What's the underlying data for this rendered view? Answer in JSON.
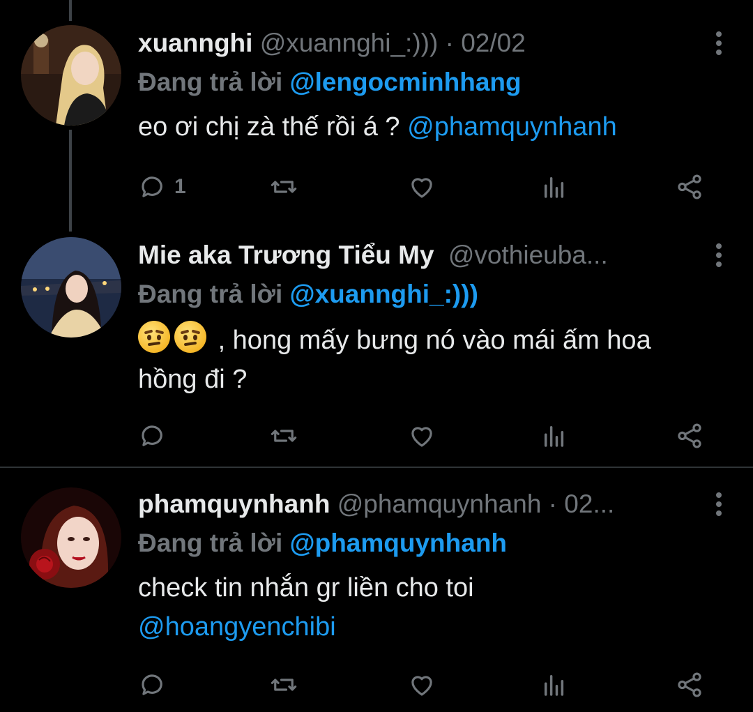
{
  "tweets": [
    {
      "display_name": "xuannghi",
      "handle": "@xuannghi_:)))",
      "separator": " · ",
      "date": "02/02",
      "reply_prefix": "Đang trả lời",
      "reply_to": "@lengocminhhang",
      "text": "eo ơi chị zà thế rồi á ?",
      "mention": "@phamquynhanh",
      "reply_count": "1"
    },
    {
      "display_name": "Mie aka Trương Tiểu My",
      "handle": "@vothieuba...",
      "reply_prefix": "Đang trả lời",
      "reply_to": "@xuannghi_:)))",
      "text_after_emoji": ", hong mấy bưng nó vào mái ấm hoa hồng đi ?",
      "emoji": "raised-eyebrow-emoji"
    },
    {
      "display_name": "phamquynhanh",
      "handle": "@phamquynhanh",
      "separator": " · ",
      "date": "02...",
      "reply_prefix": "Đang trả lời",
      "reply_to": "@phamquynhanh",
      "text": "check tin nhắn gr liền cho toi",
      "mention": "@hoangyenchibi"
    }
  ],
  "icons": [
    "reply-icon",
    "retweet-icon",
    "like-icon",
    "analytics-icon",
    "share-icon",
    "more-options-icon"
  ],
  "colors": {
    "background": "#000000",
    "accent": "#1d9bf0",
    "muted": "#71767b",
    "text": "#e7e9ea"
  }
}
